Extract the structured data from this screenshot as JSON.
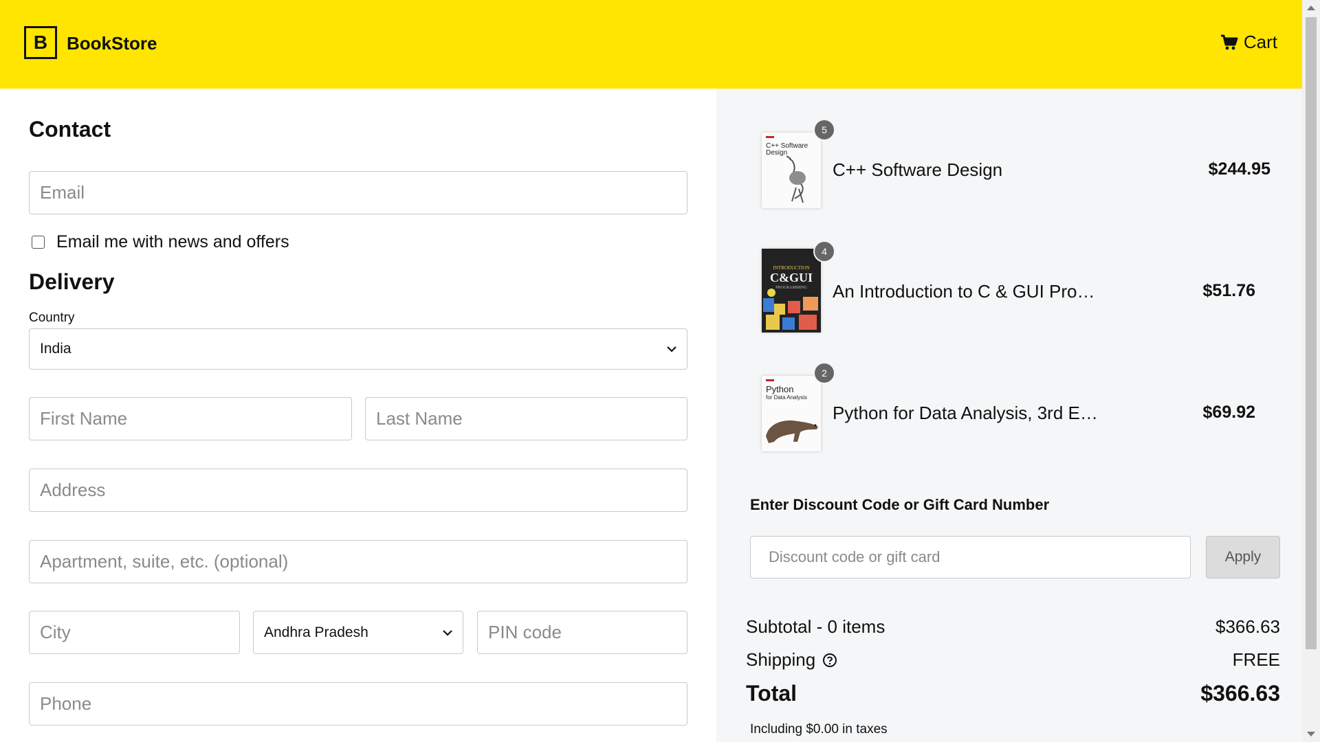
{
  "header": {
    "logo_letter": "B",
    "brand": "BookStore",
    "cart_label": "Cart",
    "bg_color": "#FFE500"
  },
  "contact": {
    "title": "Contact",
    "email_placeholder": "Email",
    "newsletter_label": "Email me with news and offers"
  },
  "delivery": {
    "title": "Delivery",
    "country_label": "Country",
    "country_value": "India",
    "first_name_placeholder": "First Name",
    "last_name_placeholder": "Last Name",
    "address_placeholder": "Address",
    "apartment_placeholder": "Apartment, suite, etc. (optional)",
    "city_placeholder": "City",
    "state_value": "Andhra Pradesh",
    "pin_placeholder": "PIN code",
    "phone_placeholder": "Phone"
  },
  "cart_items": [
    {
      "qty": "5",
      "name": "C++ Software Design",
      "price": "$244.95"
    },
    {
      "qty": "4",
      "name": "An Introduction to C & GUI Pro…",
      "price": "$51.76"
    },
    {
      "qty": "2",
      "name": "Python for Data Analysis, 3rd E…",
      "price": "$69.92"
    }
  ],
  "discount": {
    "title": "Enter Discount Code or Gift Card Number",
    "placeholder": "Discount code or gift card",
    "apply_label": "Apply"
  },
  "summary": {
    "subtotal_label": "Subtotal - 0 items",
    "subtotal_value": "$366.63",
    "shipping_label": "Shipping",
    "shipping_value": "FREE",
    "total_label": "Total",
    "total_value": "$366.63",
    "tax_note": "Including $0.00 in taxes"
  },
  "book_covers": {
    "cpp": {
      "publisher": "O'REILLY",
      "title_line1": "C++ Software",
      "title_line2": "Design"
    },
    "cgui": {
      "line1": "INTRODUCTION",
      "line2": "C&GUI",
      "line3": "PROGRAMMING"
    },
    "python": {
      "publisher": "O'REILLY",
      "title_line1": "Python",
      "title_line2": "for Data Analysis"
    }
  }
}
